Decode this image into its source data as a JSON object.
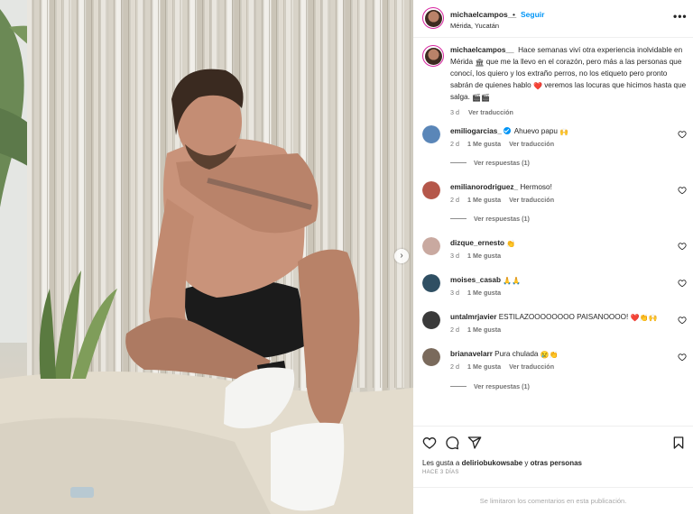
{
  "post": {
    "username": "michaelcampos__",
    "follow_label": "Seguir",
    "separator": "•",
    "location": "Mérida, Yucatán",
    "more_label": "•••",
    "next_label": "›"
  },
  "caption": {
    "username": "michaelcampos__",
    "text_part1": "Hace semanas viví otra experiencia inolvidable en Mérida ",
    "emoji1": "🏛",
    "text_part2": " que me la llevo en el corazón, pero más a las personas que conocí, los quiero y los extraño perros, no los etiqueto pero pronto sabrán de quienes hablo ",
    "emoji2": "❤️",
    "text_part3": " veremos las locuras que hicimos hasta que salga. ",
    "emoji3": "🎬🎬",
    "time": "3 d",
    "translate": "Ver traducción"
  },
  "comments": [
    {
      "username": "emiliogarcias_",
      "verified": true,
      "text": "Ahuevo papu ",
      "emoji": "🙌",
      "time": "2 d",
      "likes": "1 Me gusta",
      "translate": "Ver traducción",
      "replies": "Ver respuestas (1)",
      "avatar_color": "#5a86b8"
    },
    {
      "username": "emilianorodriguez_",
      "verified": false,
      "text": "Hermoso!",
      "emoji": "",
      "time": "2 d",
      "likes": "1 Me gusta",
      "translate": "Ver traducción",
      "replies": "Ver respuestas (1)",
      "avatar_color": "#b5574a"
    },
    {
      "username": "dizque_ernesto",
      "verified": false,
      "text": "",
      "emoji": "👏",
      "time": "3 d",
      "likes": "1 Me gusta",
      "translate": "",
      "replies": "",
      "avatar_color": "#c9a9a0"
    },
    {
      "username": "moises_casab",
      "verified": false,
      "text": "",
      "emoji": "🙏🙏",
      "time": "3 d",
      "likes": "1 Me gusta",
      "translate": "",
      "replies": "",
      "avatar_color": "#2f4f63"
    },
    {
      "username": "untalmrjavier",
      "verified": false,
      "text": "ESTILAZOOOOOOOO PAISANOOOO! ",
      "emoji": "❤️👏🙌",
      "time": "2 d",
      "likes": "1 Me gusta",
      "translate": "",
      "replies": "",
      "avatar_color": "#3a3a3a"
    },
    {
      "username": "brianavelarr",
      "verified": false,
      "text": "Pura chulada ",
      "emoji": "😢👏",
      "time": "2 d",
      "likes": "1 Me gusta",
      "translate": "Ver traducción",
      "replies": "Ver respuestas (1)",
      "avatar_color": "#7a6a5c"
    }
  ],
  "actions": {
    "likes_prefix": "Les gusta a ",
    "likes_user": "deliriobukowsabe",
    "likes_middle": " y ",
    "likes_others": "otras personas",
    "date": "HACE 3 DÍAS",
    "comments_limited": "Se limitaron los comentarios en esta publicación."
  },
  "colors": {
    "accent": "#0095f6",
    "story_ring": "#d6249f",
    "muted": "#737373"
  },
  "icons": {
    "like": "heart-icon",
    "comment": "comment-icon",
    "share": "send-icon",
    "save": "bookmark-icon",
    "more": "more-options-icon"
  }
}
